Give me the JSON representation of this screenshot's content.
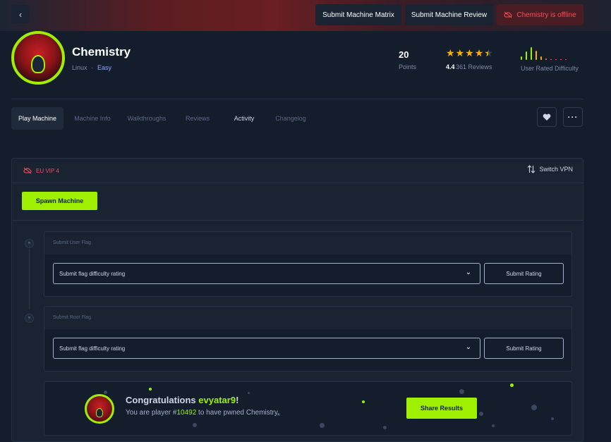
{
  "header": {
    "back_icon": "chevron-left-icon",
    "submit_matrix_label": "Submit Machine Matrix",
    "submit_review_label": "Submit Machine Review",
    "offline_label": "Chemistry is offline",
    "offline_color": "#ff4a5a"
  },
  "machine": {
    "name": "Chemistry",
    "os": "Linux",
    "separator": "·",
    "difficulty": "Easy",
    "points_value": "20",
    "points_label": "Points",
    "stars": [
      "★",
      "★",
      "★",
      "★",
      "★"
    ],
    "star_rating": 4.4,
    "rating": "4.4",
    "reviews": "361 Reviews",
    "difficulty_label": "User Rated Difficulty",
    "accent_color": "#9fef00"
  },
  "tabs": [
    {
      "label": "Play Machine",
      "active": true
    },
    {
      "label": "Machine Info"
    },
    {
      "label": "Walkthroughs"
    },
    {
      "label": "Reviews"
    },
    {
      "label": "Activity"
    },
    {
      "label": "Changelog"
    }
  ],
  "actions": {
    "favorite_icon": "heart-icon",
    "more_icon": "more-horizontal-icon"
  },
  "panel": {
    "vpn_label": "EU VIP 4",
    "switch_vpn_label": "Switch VPN",
    "spawn_label": "Spawn Machine"
  },
  "flags": [
    {
      "title": "Submit User Flag",
      "select_placeholder": "Submit flag difficulty rating",
      "button_label": "Submit Rating"
    },
    {
      "title": "Submit Root Flag",
      "select_placeholder": "Submit flag difficulty rating",
      "button_label": "Submit Rating"
    }
  ],
  "congrats": {
    "prefix": "Congratulations ",
    "username": "evyatar9",
    "suffix": "!",
    "player_prefix": "You are player #",
    "player_rank": "10492",
    "player_suffix": " to have pwned Chemistry.",
    "share_label": "Share Results"
  }
}
